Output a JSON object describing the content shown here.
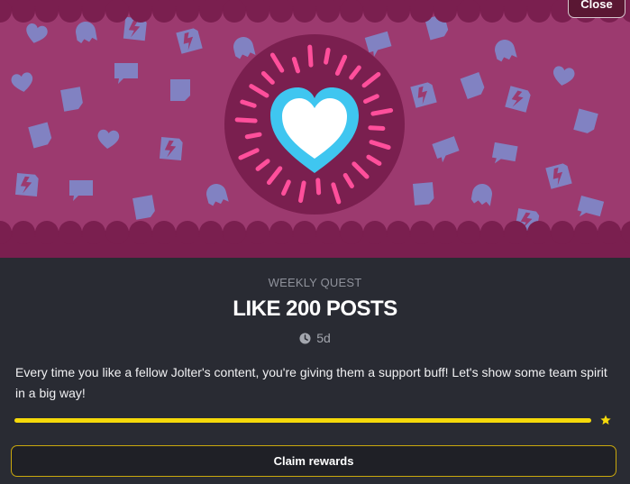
{
  "header": {
    "close_label": "Close"
  },
  "banner": {
    "badge_icon": "heart-icon",
    "pattern_icons": [
      "heart-icon",
      "chat-bubble-icon",
      "lightning-icon",
      "ghost-icon",
      "sticker-icon"
    ]
  },
  "quest": {
    "type": "WEEKLY QUEST",
    "title": "LIKE 200 POSTS",
    "time_remaining": "5d",
    "description": "Every time you like a fellow Jolter's content, you're giving them a support buff! Let's show some team spirit in a big way!",
    "progress_fraction": 1.0,
    "reward_icon": "star-icon"
  },
  "footer": {
    "claim_label": "Claim rewards"
  },
  "colors": {
    "banner_bg": "#9c3a6f",
    "banner_pattern": "#7c8fd1",
    "scallop": "#7a1f4f",
    "badge_ring": "#7a1f4f",
    "heart_outer": "#3fc6f0",
    "rays": "#ff4f9b",
    "progress": "#f5d90a",
    "claim_border": "#c9a80d"
  }
}
